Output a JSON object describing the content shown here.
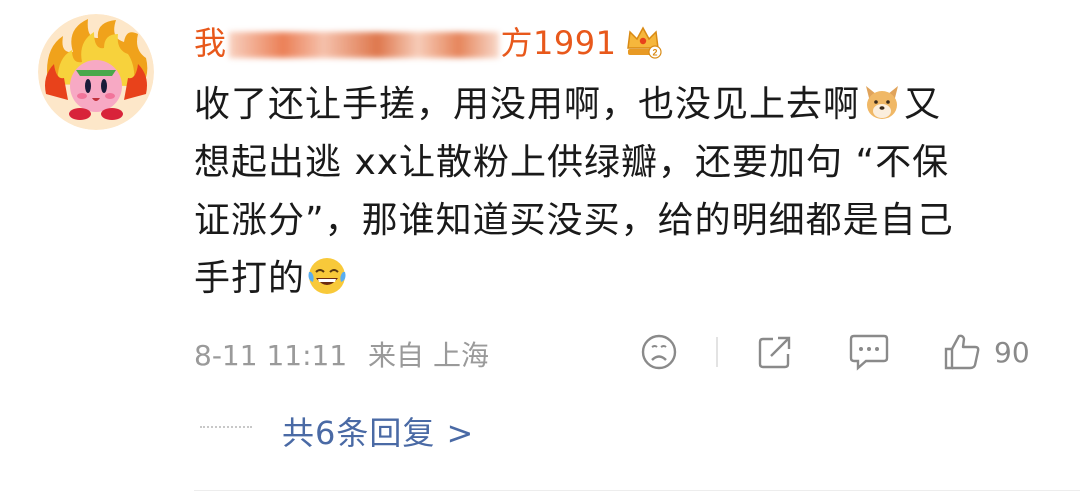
{
  "comment": {
    "username_prefix": "我",
    "username_suffix": "方1991",
    "content_lines": [
      {
        "text": "收了还让手搓，用没用啊，也没见上去啊",
        "emoji": "dog-face",
        "text_after": "又"
      },
      {
        "text": "想起出逃 xx让散粉上供绿瓣，还要加句 “不保"
      },
      {
        "text": "证涨分”，那谁知道买没买，给的明细都是自己"
      },
      {
        "text": "手打的",
        "emoji": "laugh-cry"
      }
    ],
    "timestamp": "8-11 11:11",
    "location": "来自 上海",
    "like_count": "90",
    "replies_label": "共6条回复 >"
  },
  "icons": {
    "avatar": "fire-kirby-avatar",
    "badge": "crown-badge-icon",
    "dislike": "sad-face-icon",
    "share": "share-icon",
    "comment": "comment-icon",
    "like": "thumbs-up-icon"
  },
  "colors": {
    "username": "#e8581b",
    "link": "#4a6aa5",
    "meta": "#9a9a9a",
    "text": "#1a1a1a"
  }
}
